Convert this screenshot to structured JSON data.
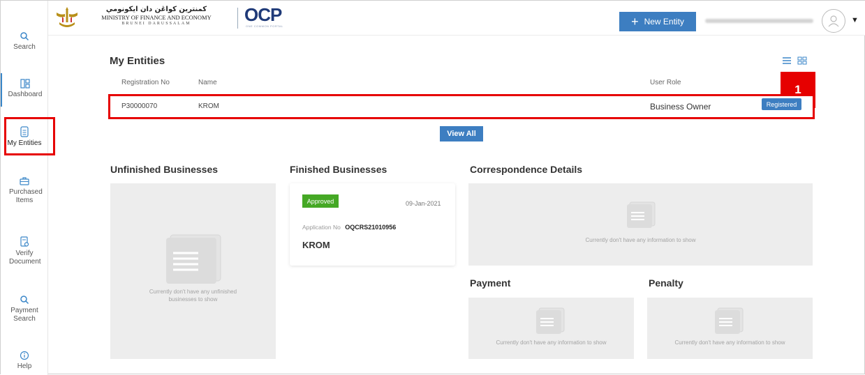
{
  "sidebar": {
    "items": [
      {
        "label": "Search",
        "icon": "search-icon"
      },
      {
        "label": "Dashboard",
        "icon": "dashboard-icon"
      },
      {
        "label": "My Entities",
        "icon": "document-icon"
      },
      {
        "label": "Purchased Items",
        "icon": "briefcase-icon"
      },
      {
        "label": "Verify Document",
        "icon": "verify-document-icon"
      },
      {
        "label": "Payment Search",
        "icon": "search-icon"
      },
      {
        "label": "Help",
        "icon": "info-icon"
      }
    ],
    "accent": "#3a86c8"
  },
  "header": {
    "ministry_ar": "كمنترين كواڠن دان ايكونومي",
    "ministry_en": "MINISTRY OF FINANCE AND ECONOMY",
    "ministry_sub": "BRUNEI DARUSSALAM",
    "logo": "OCP",
    "logo_sub": "ONE COMMON PORTAL",
    "new_entity_label": "New Entity"
  },
  "entities": {
    "title": "My Entities",
    "columns": [
      "Registration No",
      "Name",
      "User Role"
    ],
    "rows": [
      {
        "reg_no": "P30000070",
        "name": "KROM",
        "role": "Business Owner",
        "status": "Registered"
      }
    ],
    "view_all_label": "View All"
  },
  "annotation": {
    "number": "1",
    "color": "#e60000"
  },
  "unfinished": {
    "title": "Unfinished Businesses",
    "empty_line1": "Currently don't have any unfinished",
    "empty_line2": "businesses to show"
  },
  "finished": {
    "title": "Finished Businesses",
    "card": {
      "status": "Approved",
      "date": "09-Jan-2021",
      "app_no_label": "Application No",
      "app_no": "OQCRS21010956",
      "name": "KROM"
    }
  },
  "correspondence": {
    "title": "Correspondence Details",
    "empty": "Currently don't have any information to show"
  },
  "payment": {
    "title": "Payment",
    "empty": "Currently don't have any information to show"
  },
  "penalty": {
    "title": "Penalty",
    "empty": "Currently don't have any information to show"
  },
  "colors": {
    "primary": "#3d7ec1",
    "approved": "#45a825",
    "panel": "#ededed"
  }
}
